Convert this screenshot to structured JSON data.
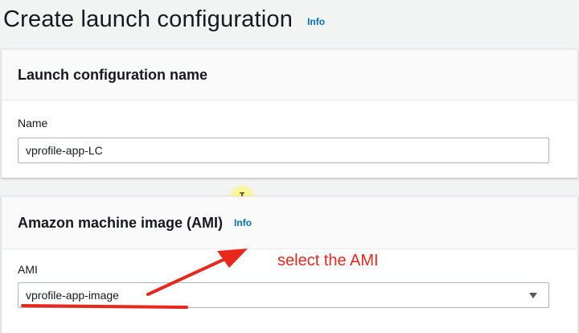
{
  "page": {
    "title": "Create launch configuration",
    "info_label": "Info"
  },
  "name_panel": {
    "title": "Launch configuration name",
    "field_label": "Name",
    "field_value": "vprofile-app-LC"
  },
  "ami_panel": {
    "title": "Amazon machine image (AMI)",
    "info_label": "Info",
    "field_label": "AMI",
    "selected_value": "vprofile-app-image"
  },
  "annotation": {
    "text": "select the AMI",
    "color": "#e8281c"
  },
  "colors": {
    "link": "#0073bb",
    "background": "#f2f3f3",
    "panel_header": "#fafafa"
  },
  "icons": {
    "dropdown": "caret-down-icon",
    "cursor": "text-cursor-icon"
  }
}
